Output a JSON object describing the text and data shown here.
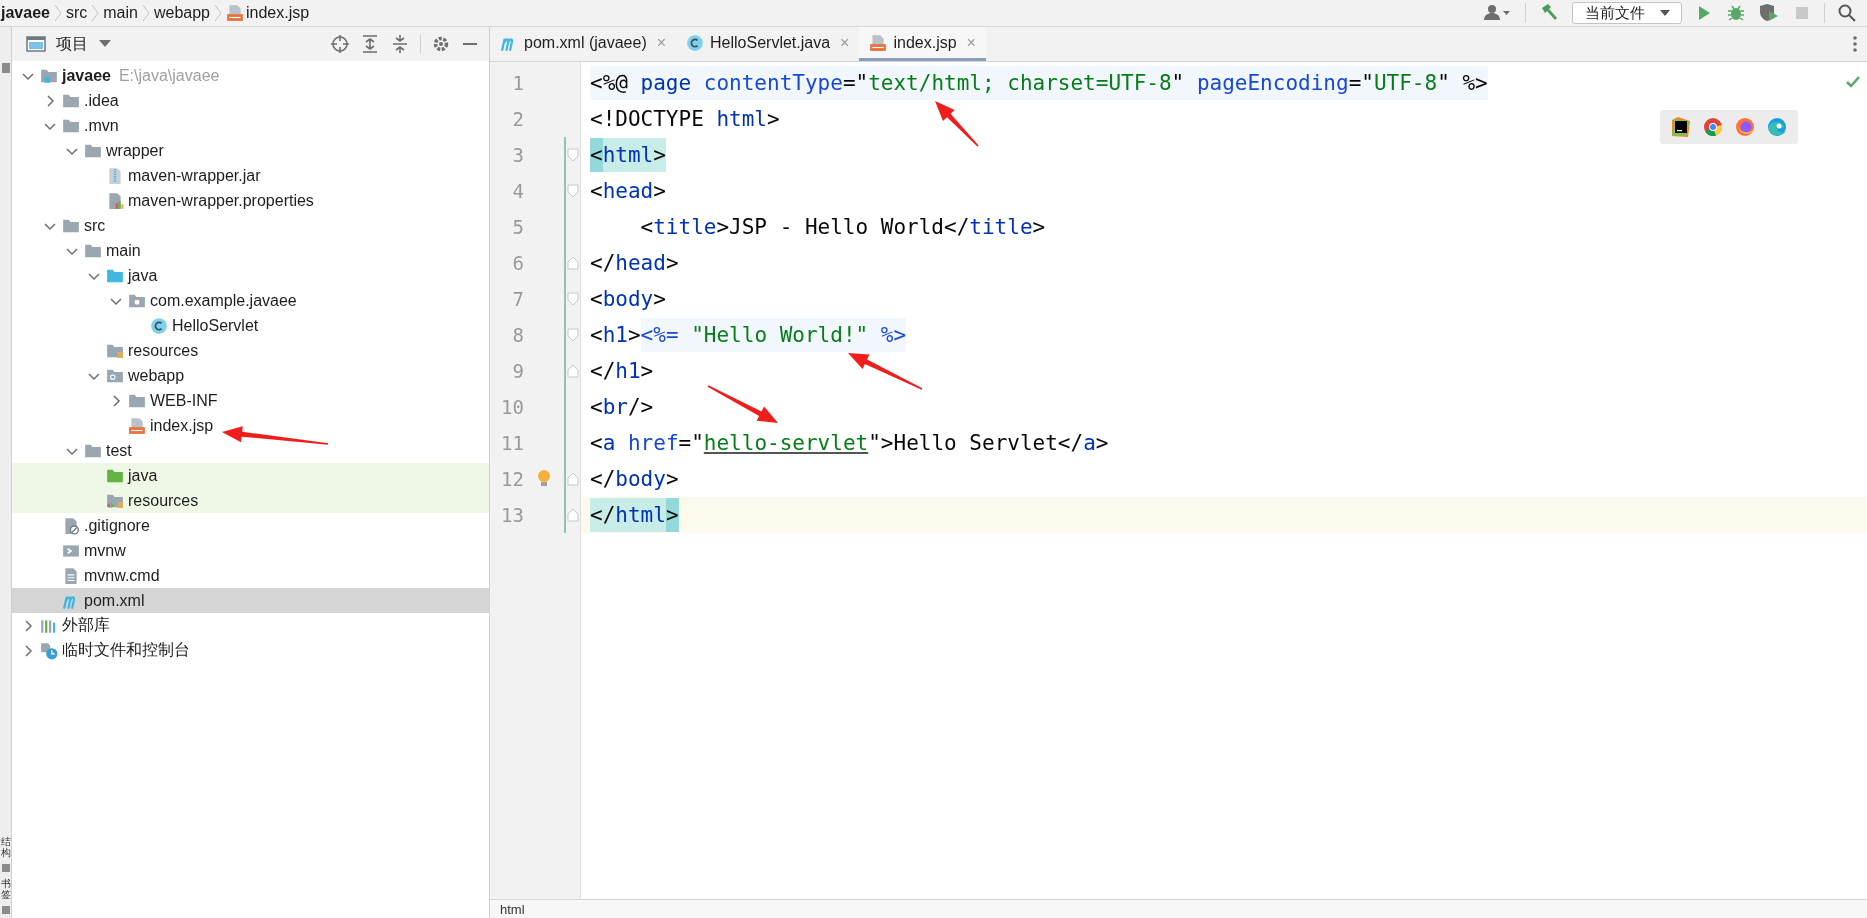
{
  "breadcrumbs": [
    {
      "label": "javaee",
      "kind": "project"
    },
    {
      "label": "src",
      "kind": "folder"
    },
    {
      "label": "main",
      "kind": "folder"
    },
    {
      "label": "webapp",
      "kind": "folder"
    },
    {
      "label": "index.jsp",
      "kind": "jsp"
    }
  ],
  "toolbar": [
    {
      "kind": "account"
    },
    {
      "kind": "build"
    },
    {
      "kind": "config",
      "label": "当前文件"
    },
    {
      "kind": "run",
      "disabled": false
    },
    {
      "kind": "debug",
      "disabled": false
    },
    {
      "kind": "coverage",
      "disabled": false
    },
    {
      "kind": "stop",
      "disabled": true
    },
    {
      "kind": "search"
    }
  ],
  "side_strip": [
    {
      "label": "结构"
    },
    {
      "label": "书签"
    }
  ],
  "project_panel": {
    "title": "项目",
    "tree": [
      {
        "label": "javaee",
        "hint": "E:\\java\\javaee",
        "kind": "module",
        "expanded": true,
        "selected": false,
        "in_test": false,
        "children": [
          {
            "label": ".idea",
            "kind": "folder",
            "expanded": false,
            "selected": false,
            "in_test": false
          },
          {
            "label": ".mvn",
            "kind": "folder",
            "expanded": true,
            "selected": false,
            "in_test": false,
            "children": [
              {
                "label": "wrapper",
                "kind": "folder",
                "expanded": true,
                "selected": false,
                "in_test": false,
                "children": [
                  {
                    "label": "maven-wrapper.jar",
                    "kind": "jar",
                    "selected": false,
                    "in_test": false
                  },
                  {
                    "label": "maven-wrapper.properties",
                    "kind": "properties",
                    "selected": false,
                    "in_test": false
                  }
                ]
              }
            ]
          },
          {
            "label": "src",
            "kind": "folder",
            "expanded": true,
            "selected": false,
            "in_test": false,
            "children": [
              {
                "label": "main",
                "kind": "folder",
                "expanded": true,
                "selected": false,
                "in_test": false,
                "children": [
                  {
                    "label": "java",
                    "kind": "source",
                    "expanded": true,
                    "selected": false,
                    "in_test": false,
                    "children": [
                      {
                        "label": "com.example.javaee",
                        "kind": "package",
                        "expanded": true,
                        "selected": false,
                        "in_test": false,
                        "children": [
                          {
                            "label": "HelloServlet",
                            "kind": "class",
                            "selected": false,
                            "in_test": false
                          }
                        ]
                      }
                    ]
                  },
                  {
                    "label": "resources",
                    "kind": "resources",
                    "selected": false,
                    "in_test": false
                  },
                  {
                    "label": "webapp",
                    "kind": "web",
                    "expanded": true,
                    "selected": false,
                    "in_test": false,
                    "children": [
                      {
                        "label": "WEB-INF",
                        "kind": "folder",
                        "expanded": false,
                        "selected": false,
                        "in_test": false
                      },
                      {
                        "label": "index.jsp",
                        "kind": "jsp",
                        "selected": false,
                        "in_test": false
                      }
                    ]
                  }
                ]
              },
              {
                "label": "test",
                "kind": "folder",
                "expanded": true,
                "selected": false,
                "in_test": false,
                "children": [
                  {
                    "label": "java",
                    "kind": "test-source",
                    "selected": false,
                    "in_test": true
                  },
                  {
                    "label": "resources",
                    "kind": "test-resources",
                    "selected": false,
                    "in_test": true
                  }
                ]
              }
            ]
          },
          {
            "label": ".gitignore",
            "kind": "ignore",
            "selected": false,
            "in_test": false
          },
          {
            "label": "mvnw",
            "kind": "script",
            "selected": false,
            "in_test": false
          },
          {
            "label": "mvnw.cmd",
            "kind": "textfile",
            "selected": false,
            "in_test": false
          },
          {
            "label": "pom.xml",
            "kind": "maven",
            "selected": true,
            "in_test": false
          }
        ]
      },
      {
        "label": "外部库",
        "kind": "library",
        "expanded": false,
        "selected": false,
        "in_test": false
      },
      {
        "label": "临时文件和控制台",
        "kind": "scratch",
        "expanded": false,
        "selected": false,
        "in_test": false
      }
    ]
  },
  "editor": {
    "tabs": [
      {
        "label": "pom.xml (javaee)",
        "kind": "maven",
        "close": "×",
        "selected": false
      },
      {
        "label": "HelloServlet.java",
        "kind": "class",
        "close": "×",
        "selected": false
      },
      {
        "label": "index.jsp",
        "kind": "jsp",
        "close": "×",
        "selected": true
      }
    ],
    "lines": [
      {
        "number": "1",
        "changed": false,
        "current": false,
        "tokens": [
          {
            "text": "<%@ ",
            "kind": "jsp-plain"
          },
          {
            "text": "page ",
            "kind": "jsp-tag"
          },
          {
            "text": "contentType",
            "kind": "jsp-attr"
          },
          {
            "text": "=\"",
            "kind": "jsp-plain"
          },
          {
            "text": "text/html; charset=UTF-8",
            "kind": "jsp-string"
          },
          {
            "text": "\" ",
            "kind": "jsp-plain"
          },
          {
            "text": "pageEncoding",
            "kind": "jsp-attr"
          },
          {
            "text": "=\"",
            "kind": "jsp-plain"
          },
          {
            "text": "UTF-8",
            "kind": "jsp-string"
          },
          {
            "text": "\" %>",
            "kind": "jsp-plain"
          }
        ]
      },
      {
        "number": "2",
        "changed": false,
        "current": false,
        "tokens": [
          {
            "text": "<!DOCTYPE ",
            "kind": "plain"
          },
          {
            "text": "html",
            "kind": "tag"
          },
          {
            "text": ">",
            "kind": "plain"
          }
        ]
      },
      {
        "number": "3",
        "changed": true,
        "current": false,
        "fold": {
          "kind": "start"
        },
        "tokens": [
          {
            "text": "<",
            "kind": "match-edge"
          },
          {
            "text": "html",
            "kind": "match-tag"
          },
          {
            "text": ">",
            "kind": "match-plain"
          }
        ]
      },
      {
        "number": "4",
        "changed": true,
        "current": false,
        "fold": {
          "kind": "start"
        },
        "tokens": [
          {
            "text": "<",
            "kind": "plain"
          },
          {
            "text": "head",
            "kind": "tag"
          },
          {
            "text": ">",
            "kind": "plain"
          }
        ]
      },
      {
        "number": "5",
        "changed": true,
        "current": false,
        "tokens": [
          {
            "text": "    <",
            "kind": "plain"
          },
          {
            "text": "title",
            "kind": "tag"
          },
          {
            "text": ">JSP - Hello World</",
            "kind": "plain"
          },
          {
            "text": "title",
            "kind": "tag"
          },
          {
            "text": ">",
            "kind": "plain"
          }
        ]
      },
      {
        "number": "6",
        "changed": true,
        "current": false,
        "fold": {
          "kind": "end"
        },
        "tokens": [
          {
            "text": "</",
            "kind": "plain"
          },
          {
            "text": "head",
            "kind": "tag"
          },
          {
            "text": ">",
            "kind": "plain"
          }
        ]
      },
      {
        "number": "7",
        "changed": true,
        "current": false,
        "fold": {
          "kind": "start"
        },
        "tokens": [
          {
            "text": "<",
            "kind": "plain"
          },
          {
            "text": "body",
            "kind": "tag"
          },
          {
            "text": ">",
            "kind": "plain"
          }
        ]
      },
      {
        "number": "8",
        "changed": true,
        "current": false,
        "fold": {
          "kind": "start"
        },
        "tokens": [
          {
            "text": "<",
            "kind": "plain"
          },
          {
            "text": "h1",
            "kind": "tag"
          },
          {
            "text": ">",
            "kind": "plain"
          },
          {
            "text": "<%= ",
            "kind": "jsp-attr"
          },
          {
            "text": "\"Hello World!\" ",
            "kind": "jsp-string"
          },
          {
            "text": "%>",
            "kind": "jsp-attr"
          }
        ]
      },
      {
        "number": "9",
        "changed": true,
        "current": false,
        "fold": {
          "kind": "end"
        },
        "tokens": [
          {
            "text": "</",
            "kind": "plain"
          },
          {
            "text": "h1",
            "kind": "tag"
          },
          {
            "text": ">",
            "kind": "plain"
          }
        ]
      },
      {
        "number": "10",
        "changed": true,
        "current": false,
        "tokens": [
          {
            "text": "<",
            "kind": "plain"
          },
          {
            "text": "br",
            "kind": "tag"
          },
          {
            "text": "/>",
            "kind": "plain"
          }
        ]
      },
      {
        "number": "11",
        "changed": true,
        "current": false,
        "tokens": [
          {
            "text": "<",
            "kind": "plain"
          },
          {
            "text": "a ",
            "kind": "tag"
          },
          {
            "text": "href",
            "kind": "attr"
          },
          {
            "text": "=\"",
            "kind": "plain"
          },
          {
            "text": "hello-servlet",
            "kind": "link"
          },
          {
            "text": "\">Hello Servlet</",
            "kind": "plain"
          },
          {
            "text": "a",
            "kind": "tag"
          },
          {
            "text": ">",
            "kind": "plain"
          }
        ]
      },
      {
        "number": "12",
        "changed": true,
        "current": false,
        "fold": {
          "kind": "end"
        },
        "bulb": true,
        "tokens": [
          {
            "text": "</",
            "kind": "plain"
          },
          {
            "text": "body",
            "kind": "tag"
          },
          {
            "text": ">",
            "kind": "plain"
          }
        ]
      },
      {
        "number": "13",
        "changed": true,
        "current": true,
        "fold": {
          "kind": "end"
        },
        "tokens": [
          {
            "text": "</",
            "kind": "match-plain"
          },
          {
            "text": "html",
            "kind": "match-tag"
          },
          {
            "text": ">",
            "kind": "match-edge"
          }
        ]
      }
    ],
    "status": "html"
  }
}
